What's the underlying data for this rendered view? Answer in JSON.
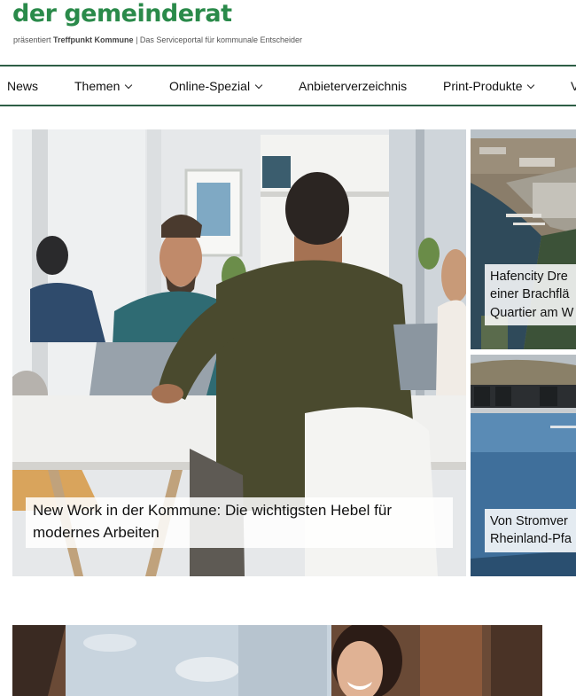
{
  "header": {
    "logo": "der gemeinderat",
    "tagline_prefix": "präsentiert",
    "tagline_brand": "Treffpunkt Kommune",
    "tagline_suffix": "| Das Serviceportal für kommunale Entscheider"
  },
  "nav": {
    "items": [
      {
        "label": "News",
        "dropdown": false
      },
      {
        "label": "Themen",
        "dropdown": true
      },
      {
        "label": "Online-Spezial",
        "dropdown": true
      },
      {
        "label": "Anbieterverzeichnis",
        "dropdown": false
      },
      {
        "label": "Print-Produkte",
        "dropdown": true
      },
      {
        "label": "V",
        "dropdown": false
      }
    ]
  },
  "teasers": {
    "main": {
      "title": "New Work in der Kommune: Die wichtigsten Hebel für modernes Arbeiten"
    },
    "side_top": {
      "line1": "Hafencity Dre",
      "line2": "einer Brachflä",
      "line3": "Quartier am W"
    },
    "side_bottom": {
      "line1": "Von Stromver",
      "line2": "Rheinland-Pfa"
    }
  },
  "colors": {
    "logo_green": "#2a8a4a",
    "nav_border": "#2e5e46"
  }
}
